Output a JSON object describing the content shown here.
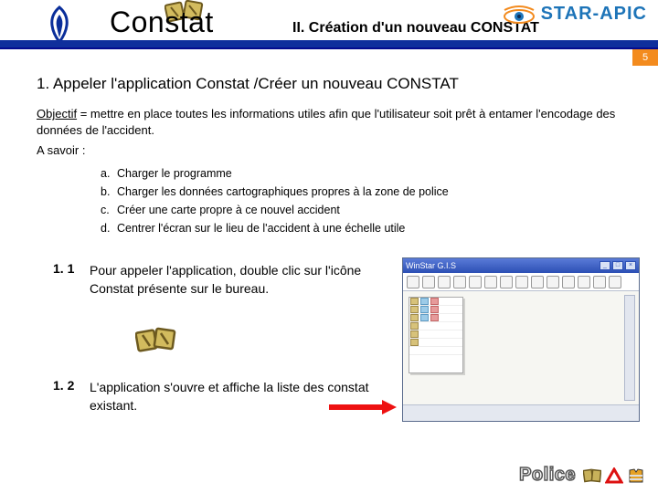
{
  "header": {
    "app_name": "Constat",
    "chapter": "II.  Création d'un nouveau CONSTAT",
    "brand": "STAR-APIC",
    "slide_number": "5"
  },
  "section_title": "1. Appeler l'application Constat /Créer un nouveau CONSTAT",
  "objectif_label": "Objectif",
  "objectif_text": " = mettre en place toutes les informations utiles afin que l'utilisateur soit prêt à entamer l'encodage des données de l'accident.",
  "savoir": "A savoir :",
  "steps": [
    {
      "label": "a.",
      "text": "Charger le programme"
    },
    {
      "label": "b.",
      "text": "Charger les données cartographiques propres à la zone de police"
    },
    {
      "label": "c.",
      "text": "Créer une carte propre à ce nouvel accident"
    },
    {
      "label": "d.",
      "text": "Centrer l'écran sur le lieu de l'accident à une échelle utile"
    }
  ],
  "sub11": {
    "num": "1. 1",
    "text": "Pour appeler l'application, double clic sur l'icône Constat présente sur le bureau."
  },
  "sub12": {
    "num": "1. 2",
    "text": "L'application s'ouvre et affiche la liste des constat existant."
  },
  "app_window": {
    "title": "WinStar  G.I.S"
  },
  "footer": {
    "police": "Police"
  }
}
